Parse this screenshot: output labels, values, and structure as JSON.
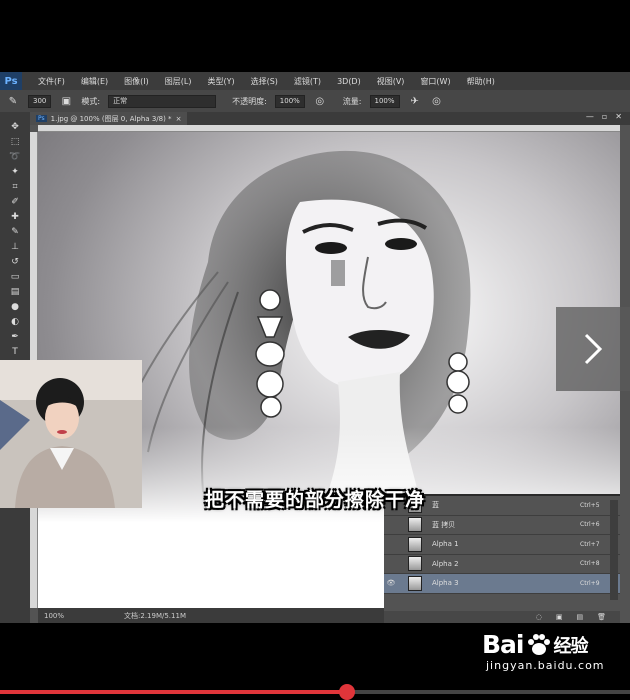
{
  "menu": {
    "logo": "Ps",
    "items": [
      "文件(F)",
      "编辑(E)",
      "图像(I)",
      "图层(L)",
      "类型(Y)",
      "选择(S)",
      "滤镜(T)",
      "3D(D)",
      "视图(V)",
      "窗口(W)",
      "帮助(H)"
    ]
  },
  "options": {
    "brush_size": "300",
    "mode_label": "模式:",
    "mode_value": "正常",
    "opacity_label": "不透明度:",
    "opacity_value": "100%",
    "flow_label": "流量:",
    "flow_value": "100%"
  },
  "document": {
    "tab_title": "1.jpg @ 100% (图层 0, Alpha 3/8) *",
    "close": "×"
  },
  "status": {
    "zoom": "100%",
    "doc_info": "文档:2.19M/5.11M"
  },
  "layers": [
    {
      "name": "蓝",
      "shortcut": "Ctrl+5",
      "visible": "",
      "active": false
    },
    {
      "name": "蓝 拷贝",
      "shortcut": "Ctrl+6",
      "visible": "",
      "active": false
    },
    {
      "name": "Alpha 1",
      "shortcut": "Ctrl+7",
      "visible": "",
      "active": false
    },
    {
      "name": "Alpha 2",
      "shortcut": "Ctrl+8",
      "visible": "",
      "active": false
    },
    {
      "name": "Alpha 3",
      "shortcut": "Ctrl+9",
      "visible": "👁",
      "active": true
    }
  ],
  "subtitle": "把不需要的部分擦除干净",
  "watermark": {
    "logo": "Bai",
    "logo_suffix": "经验",
    "site": "jingyan.baidu.com"
  },
  "video": {
    "progress_percent": 55
  },
  "colors": {
    "accent": "#e0353a",
    "ps_blue": "#1f3f66",
    "active_layer": "#6b7a8f"
  },
  "icons": {
    "next": "chevron-right-icon",
    "paw": "paw-icon"
  }
}
